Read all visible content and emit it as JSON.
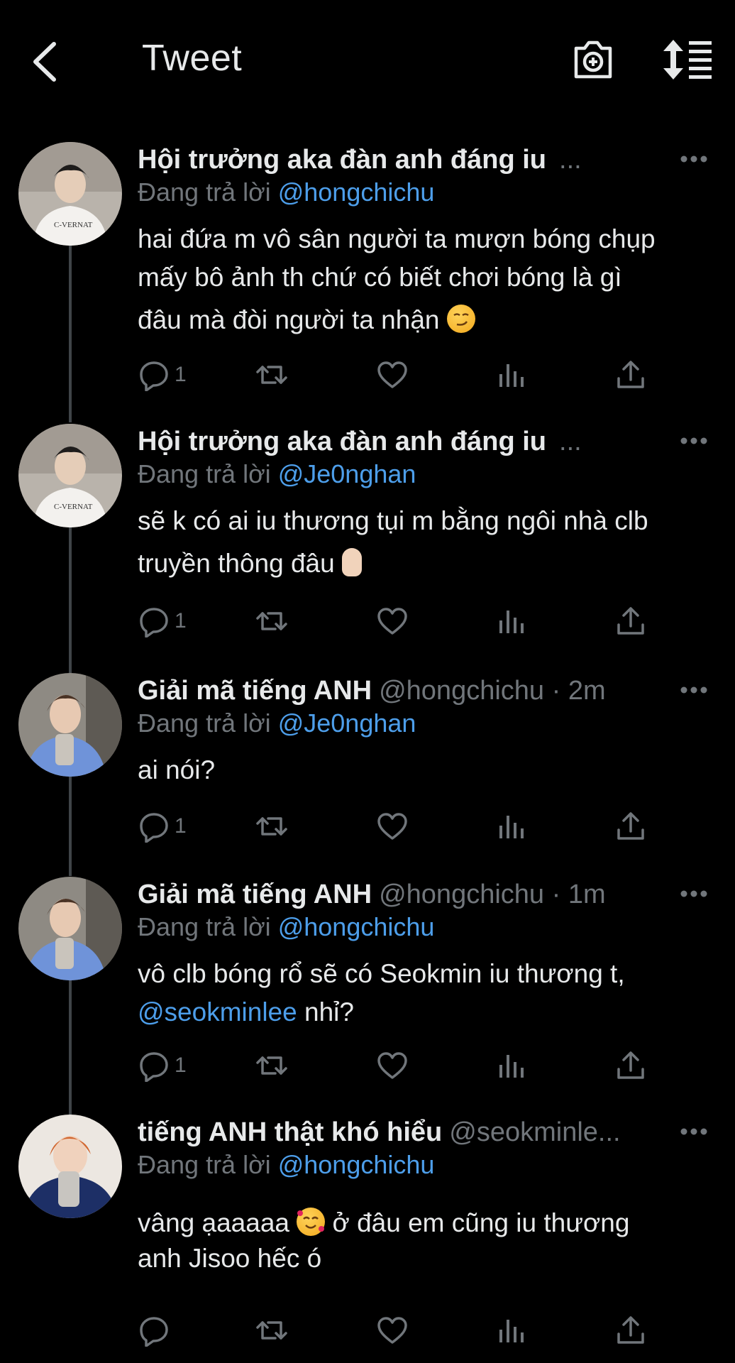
{
  "header": {
    "title": "Tweet"
  },
  "tweets": [
    {
      "name": "Hội trưởng aka đàn anh đáng iu",
      "handle": "",
      "ellipsis": "...",
      "reply_prefix": "Đang trả lời",
      "reply_to": "@hongchichu",
      "text_1": "hai đứa m vô sân người ta mượn bóng chụp",
      "text_2": "mấy bô ảnh th chứ có biết chơi bóng là gì",
      "text_3": "đâu mà đòi người ta nhận",
      "emoji": "smirking-face",
      "reply_count": "1"
    },
    {
      "name": "Hội trưởng aka đàn anh đáng iu",
      "handle": "",
      "ellipsis": "...",
      "reply_prefix": "Đang trả lời",
      "reply_to": "@Je0nghan",
      "text_1": "sẽ k có ai iu thương tụi m bằng ngôi nhà clb",
      "text_2": "truyền thông đâu",
      "emoji": "crossed-fingers",
      "reply_count": "1"
    },
    {
      "name": "Giải mã tiếng ANH",
      "handle": "@hongchichu · 2m",
      "reply_prefix": "Đang trả lời",
      "reply_to": "@Je0nghan",
      "text_1": "ai nói?",
      "reply_count": "1"
    },
    {
      "name": "Giải mã tiếng ANH",
      "handle": "@hongchichu · 1m",
      "reply_prefix": "Đang trả lời",
      "reply_to": "@hongchichu",
      "text_1": "vô clb bóng rổ sẽ có Seokmin iu thương t,",
      "mention": "@seokminlee",
      "text_2": " nhỉ?",
      "reply_count": "1"
    },
    {
      "name": "tiếng ANH thật khó hiểu",
      "handle": "@seokminle...",
      "reply_prefix": "Đang trả lời",
      "reply_to": "@hongchichu",
      "text_1a": "vâng ạaaaaa",
      "text_1b": "ở đâu em cũng iu thương",
      "text_2": "anh Jisoo hếc ó",
      "emoji": "smiling-face-with-hearts",
      "reply_count": ""
    }
  ],
  "icons": [
    "back-arrow-icon",
    "camera-icon",
    "sort-icon",
    "more-icon",
    "reply-icon",
    "retweet-icon",
    "like-icon",
    "views-icon",
    "share-icon"
  ],
  "colors": {
    "background": "#000000",
    "text": "#e7e9ea",
    "muted": "#71767b",
    "link": "#4d9eea",
    "thread_line": "#3f4448"
  }
}
